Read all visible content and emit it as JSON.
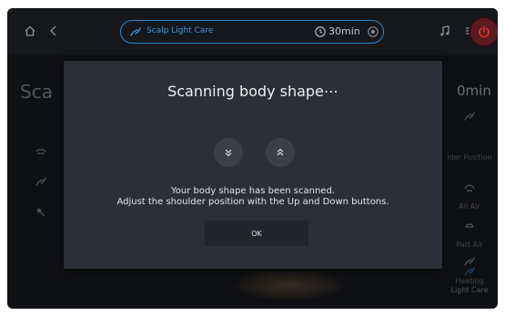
{
  "topbar": {
    "mode_label": "Scalp Light Care",
    "timer_label": "30min",
    "icons": [
      "home-icon",
      "back-icon",
      "scalp-care-icon",
      "clock-icon",
      "timer-extra-icon",
      "music-icon",
      "list-icon",
      "power-icon"
    ],
    "accent_color": "#2f86c9",
    "power_color": "#e0323a"
  },
  "background": {
    "left_title": "Sca",
    "right_timer": "0min",
    "right_items": [
      {
        "label": "",
        "icon": "scalp-care-icon"
      },
      {
        "label": "lder Position",
        "icon": "shoulder-icon"
      },
      {
        "label": "All Air",
        "icon": "all-air-icon"
      },
      {
        "label": "Part Air",
        "icon": "part-air-icon"
      },
      {
        "label": "Heating",
        "icon": "heating-icon"
      },
      {
        "label": "Light Care",
        "icon": "light-care-icon"
      }
    ]
  },
  "dialog": {
    "title": "Scanning body shape⋯",
    "message_line1": "Your body shape has been scanned.",
    "message_line2": "Adjust the shoulder position with the Up and Down buttons.",
    "ok_label": "OK",
    "buttons": [
      "chevron-double-down-icon",
      "chevron-double-up-icon"
    ]
  }
}
